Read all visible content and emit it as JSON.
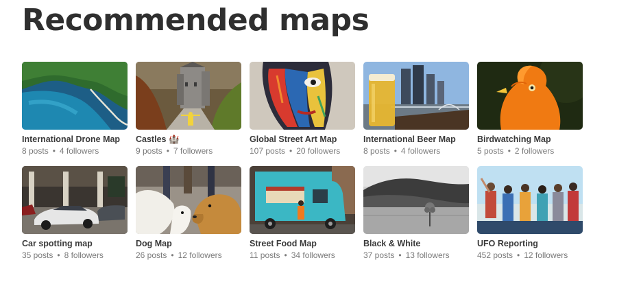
{
  "page": {
    "title": "Recommended maps"
  },
  "maps": [
    {
      "title": "International Drone Map",
      "posts": "8 posts",
      "followers": "4 followers",
      "thumb_icon": "aerial-coast-image"
    },
    {
      "title": "Castles",
      "title_emoji": "🏰",
      "posts": "9 posts",
      "followers": "7 followers",
      "thumb_icon": "castle-image"
    },
    {
      "title": "Global Street Art Map",
      "posts": "107 posts",
      "followers": "20 followers",
      "thumb_icon": "street-art-face-image"
    },
    {
      "title": "International Beer Map",
      "posts": "8 posts",
      "followers": "4 followers",
      "thumb_icon": "beer-glass-city-image"
    },
    {
      "title": "Birdwatching Map",
      "posts": "5 posts",
      "followers": "2 followers",
      "thumb_icon": "orange-bird-image"
    },
    {
      "title": "Car spotting map",
      "posts": "35 posts",
      "followers": "8 followers",
      "thumb_icon": "supercar-image"
    },
    {
      "title": "Dog Map",
      "posts": "26 posts",
      "followers": "12 followers",
      "thumb_icon": "dogs-image"
    },
    {
      "title": "Street Food Map",
      "posts": "11 posts",
      "followers": "34 followers",
      "thumb_icon": "food-truck-image"
    },
    {
      "title": "Black & White",
      "posts": "37 posts",
      "followers": "13 followers",
      "thumb_icon": "bw-landscape-image"
    },
    {
      "title": "UFO Reporting",
      "posts": "452 posts",
      "followers": "12 followers",
      "thumb_icon": "group-people-image"
    }
  ],
  "separator": "•",
  "colors": {
    "title_text": "#2f2f2f",
    "card_title_text": "#3a3a3a",
    "meta_text": "#7a7a7a"
  }
}
